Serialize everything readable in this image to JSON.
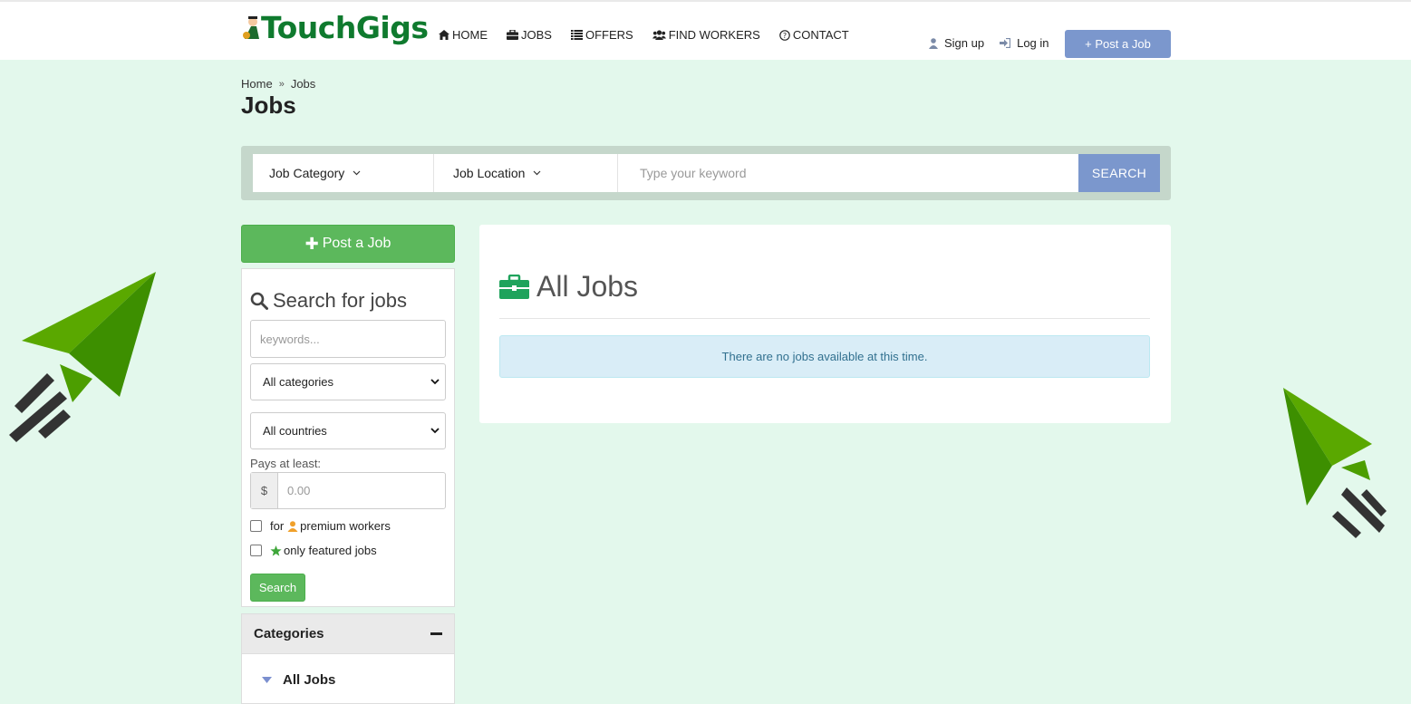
{
  "brand": {
    "name": "TouchGigs"
  },
  "nav": {
    "items": [
      {
        "label": "HOME",
        "icon": "home-icon"
      },
      {
        "label": "JOBS",
        "icon": "briefcase-icon"
      },
      {
        "label": "OFFERS",
        "icon": "list-icon"
      },
      {
        "label": "FIND WORKERS",
        "icon": "users-icon"
      },
      {
        "label": "CONTACT",
        "icon": "question-circle-icon"
      }
    ]
  },
  "auth": {
    "signup": "Sign up",
    "login": "Log in",
    "post_job": "+ Post a Job"
  },
  "breadcrumb": {
    "home": "Home",
    "current": "Jobs"
  },
  "page": {
    "title": "Jobs"
  },
  "searchbar": {
    "category": "Job Category",
    "location": "Job Location",
    "keyword_placeholder": "Type your keyword",
    "button": "SEARCH"
  },
  "sidebar": {
    "post_job": "Post a Job",
    "search_title": "Search for jobs",
    "keywords_placeholder": "keywords...",
    "category_select": "All categories",
    "country_select": "All countries",
    "pays_label": "Pays at least:",
    "currency": "$",
    "pay_placeholder": "0.00",
    "premium_prefix": "for",
    "premium_label": "premium workers",
    "featured_label": "only featured jobs",
    "search_button": "Search"
  },
  "categories": {
    "title": "Categories",
    "items": [
      {
        "label": "All Jobs"
      }
    ]
  },
  "main": {
    "title": "All Jobs",
    "empty_message": "There are no jobs available at this time."
  },
  "colors": {
    "brand_green": "#0f7a2e",
    "accent_blue": "#7b97cd",
    "success_green": "#5cb85c",
    "background": "#e3f8ec"
  }
}
